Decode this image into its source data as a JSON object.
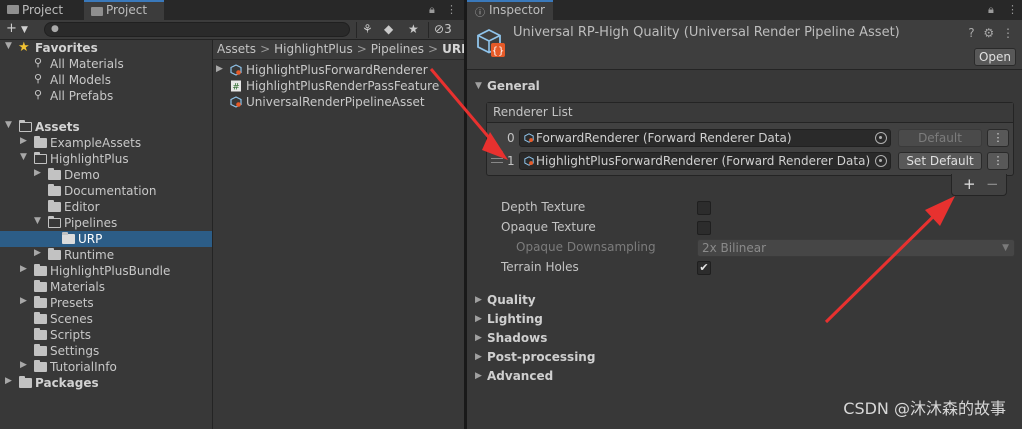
{
  "project": {
    "tabs": [
      {
        "label": "Project",
        "icon": "folder-icon"
      },
      {
        "label": "Project",
        "icon": "folder-icon"
      }
    ],
    "toolbar": {
      "add_label": "+",
      "hidden_count": "3"
    },
    "tree": {
      "favorites": "Favorites",
      "fav_items": [
        "All Materials",
        "All Models",
        "All Prefabs"
      ],
      "assets": "Assets",
      "example_assets": "ExampleAssets",
      "highlight_plus": "HighlightPlus",
      "demo": "Demo",
      "documentation": "Documentation",
      "editor": "Editor",
      "pipelines": "Pipelines",
      "urp": "URP",
      "runtime": "Runtime",
      "hp_bundle": "HighlightPlusBundle",
      "materials": "Materials",
      "presets": "Presets",
      "scenes": "Scenes",
      "scripts": "Scripts",
      "settings": "Settings",
      "tutorial_info": "TutorialInfo",
      "packages": "Packages"
    },
    "breadcrumb": {
      "items": [
        "Assets",
        "HighlightPlus",
        "Pipelines"
      ],
      "current": "URP",
      "separator": ">"
    },
    "files": [
      {
        "name": "HighlightPlusForwardRenderer",
        "icon": "renderer-asset-icon"
      },
      {
        "name": "HighlightPlusRenderPassFeature",
        "icon": "csharp-script-icon"
      },
      {
        "name": "UniversalRenderPipelineAsset",
        "icon": "pipeline-asset-icon"
      }
    ]
  },
  "inspector": {
    "tab_label": "Inspector",
    "asset_title": "Universal RP-High Quality (Universal Render Pipeline Asset)",
    "open_label": "Open",
    "general_label": "General",
    "renderer_list": {
      "title": "Renderer List",
      "rows": [
        {
          "index": "0",
          "value": "ForwardRenderer (Forward Renderer Data)",
          "button": "Default",
          "button_enabled": false
        },
        {
          "index": "1",
          "value": "HighlightPlusForwardRenderer (Forward Renderer Data)",
          "button": "Set Default",
          "button_enabled": true
        }
      ],
      "add_label": "+",
      "remove_label": "−"
    },
    "props": {
      "depth_texture": {
        "label": "Depth Texture",
        "checked": false
      },
      "opaque_texture": {
        "label": "Opaque Texture",
        "checked": false
      },
      "opaque_downsampling": {
        "label": "Opaque Downsampling",
        "value": "2x Bilinear"
      },
      "terrain_holes": {
        "label": "Terrain Holes",
        "checked": true
      }
    },
    "sections": [
      "Quality",
      "Lighting",
      "Shadows",
      "Post-processing",
      "Advanced"
    ]
  },
  "watermark": "CSDN @沐沐森的故事",
  "colors": {
    "selection": "#2c5d87",
    "annotation_arrow": "#e8312f",
    "favorite_star": "#f1c232",
    "tab_accent": "#3a79bb"
  }
}
